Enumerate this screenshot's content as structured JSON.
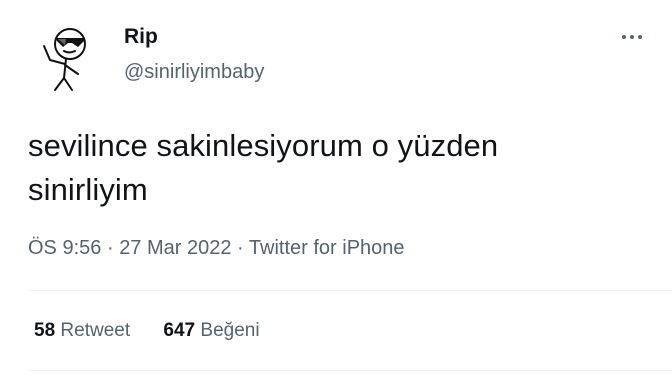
{
  "tweet": {
    "author": {
      "display_name": "Rip",
      "handle": "@sinirliyimbaby",
      "avatar_icon": "stick-figure-sunglasses-icon"
    },
    "more_icon": "more-options-icon",
    "text_line1": "sevilince sakinlesiyorum o yüzden",
    "text_line2": "sinirliyim",
    "time": "ÖS 9:56",
    "separator": "·",
    "date": "27 Mar 2022",
    "source": "Twitter for iPhone",
    "stats": {
      "retweets_count": "58",
      "retweets_label": "Retweet",
      "likes_count": "647",
      "likes_label": "Beğeni"
    }
  },
  "colors": {
    "text_primary": "#0f1419",
    "text_secondary": "#536471",
    "divider": "#eff3f4"
  }
}
